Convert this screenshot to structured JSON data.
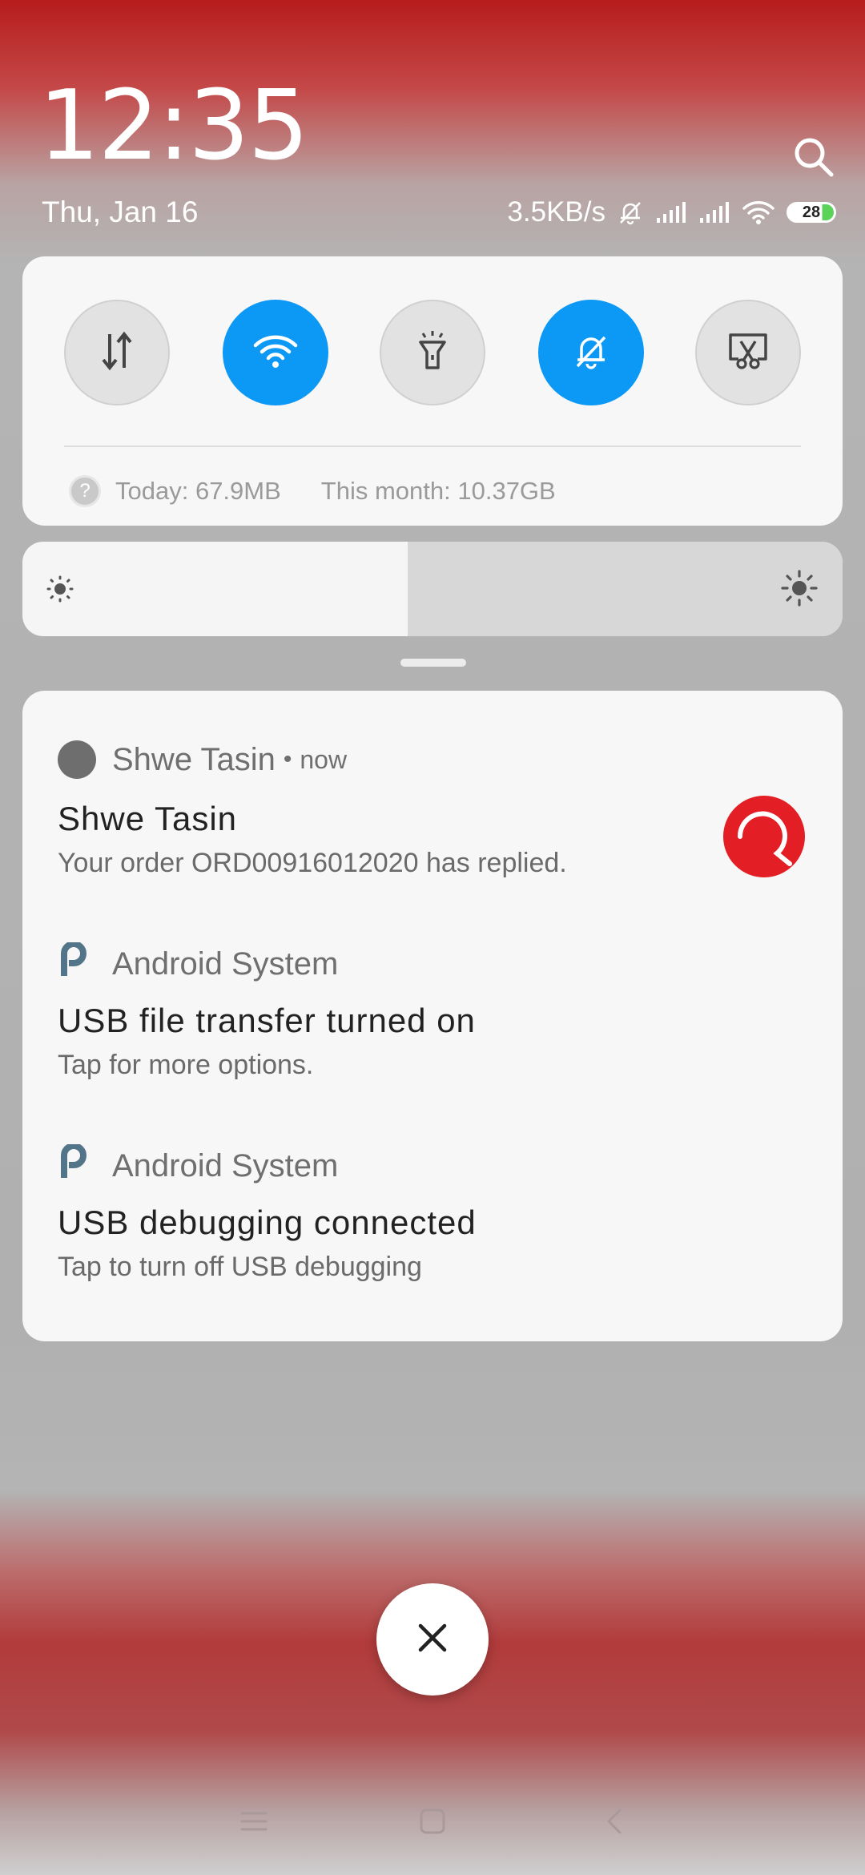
{
  "header": {
    "time": "12:35",
    "date": "Thu, Jan 16",
    "net_speed": "3.5KB/s",
    "battery_level": "28"
  },
  "icons": {
    "search": "search-icon",
    "mute": "bell-off-icon",
    "signal1": "signal-icon",
    "signal2": "signal-icon",
    "wifi": "wifi-icon",
    "battery": "battery-icon"
  },
  "quick_settings": {
    "toggles": [
      {
        "name": "mobile-data",
        "icon": "data-arrows-icon",
        "on": false
      },
      {
        "name": "wifi",
        "icon": "wifi-icon",
        "on": true
      },
      {
        "name": "flashlight",
        "icon": "flashlight-icon",
        "on": false
      },
      {
        "name": "silent",
        "icon": "bell-off-icon",
        "on": true
      },
      {
        "name": "screenshot",
        "icon": "scissors-screen-icon",
        "on": false
      }
    ],
    "usage_today": "Today: 67.9MB",
    "usage_month": "This month: 10.37GB"
  },
  "brightness": {
    "level": 0.47
  },
  "notifications": [
    {
      "app": "Shwe Tasin",
      "time": "now",
      "title": "Shwe Tasin",
      "text": "Your order ORD00916012020 has replied."
    },
    {
      "app": "Android System",
      "title": "USB file transfer turned on",
      "text": "Tap for more options."
    },
    {
      "app": "Android System",
      "title": "USB debugging connected",
      "text": "Tap to turn off USB debugging"
    }
  ],
  "colors": {
    "accent": "#0c98f5",
    "shwe_tasin_logo": "#e31e24",
    "top_bar": "#b71c1c"
  }
}
